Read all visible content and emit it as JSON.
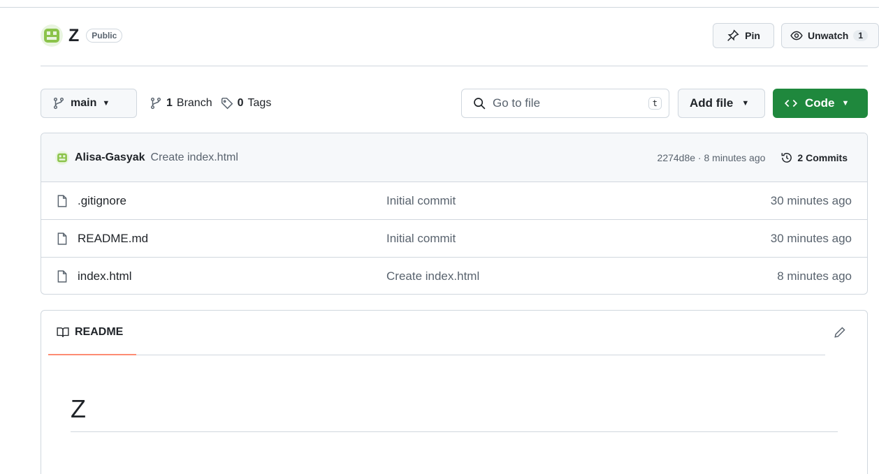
{
  "repo": {
    "name": "Z",
    "visibility": "Public",
    "pin_label": "Pin",
    "unwatch_label": "Unwatch",
    "watch_count": "1"
  },
  "toolbar": {
    "branch": "main",
    "branch_count": "1",
    "branch_label": "Branch",
    "tag_count": "0",
    "tag_label": "Tags",
    "search_placeholder": "Go to file",
    "search_shortcut": "t",
    "add_file_label": "Add file",
    "code_label": "Code"
  },
  "latest_commit": {
    "author": "Alisa-Gasyak",
    "message": "Create index.html",
    "sha_time": "2274d8e · 8 minutes ago",
    "commits_label": "2 Commits"
  },
  "files": [
    {
      "name": ".gitignore",
      "commit": "Initial commit",
      "time": "30 minutes ago"
    },
    {
      "name": "README.md",
      "commit": "Initial commit",
      "time": "30 minutes ago"
    },
    {
      "name": "index.html",
      "commit": "Create index.html",
      "time": "8 minutes ago"
    }
  ],
  "readme": {
    "tab_label": "README",
    "heading": "Z"
  },
  "colors": {
    "primary_button": "#1f883d",
    "tab_underline": "#fd8c73",
    "avatar_green": "#8bc34a"
  },
  "icons": {
    "avatar": "identicon",
    "pin": "pin-icon",
    "eye": "eye-icon",
    "branch": "git-branch-icon",
    "tag": "tag-icon",
    "search": "search-icon",
    "code": "code-icon",
    "history": "history-icon",
    "file": "file-icon",
    "book": "book-icon",
    "pencil": "pencil-icon"
  }
}
